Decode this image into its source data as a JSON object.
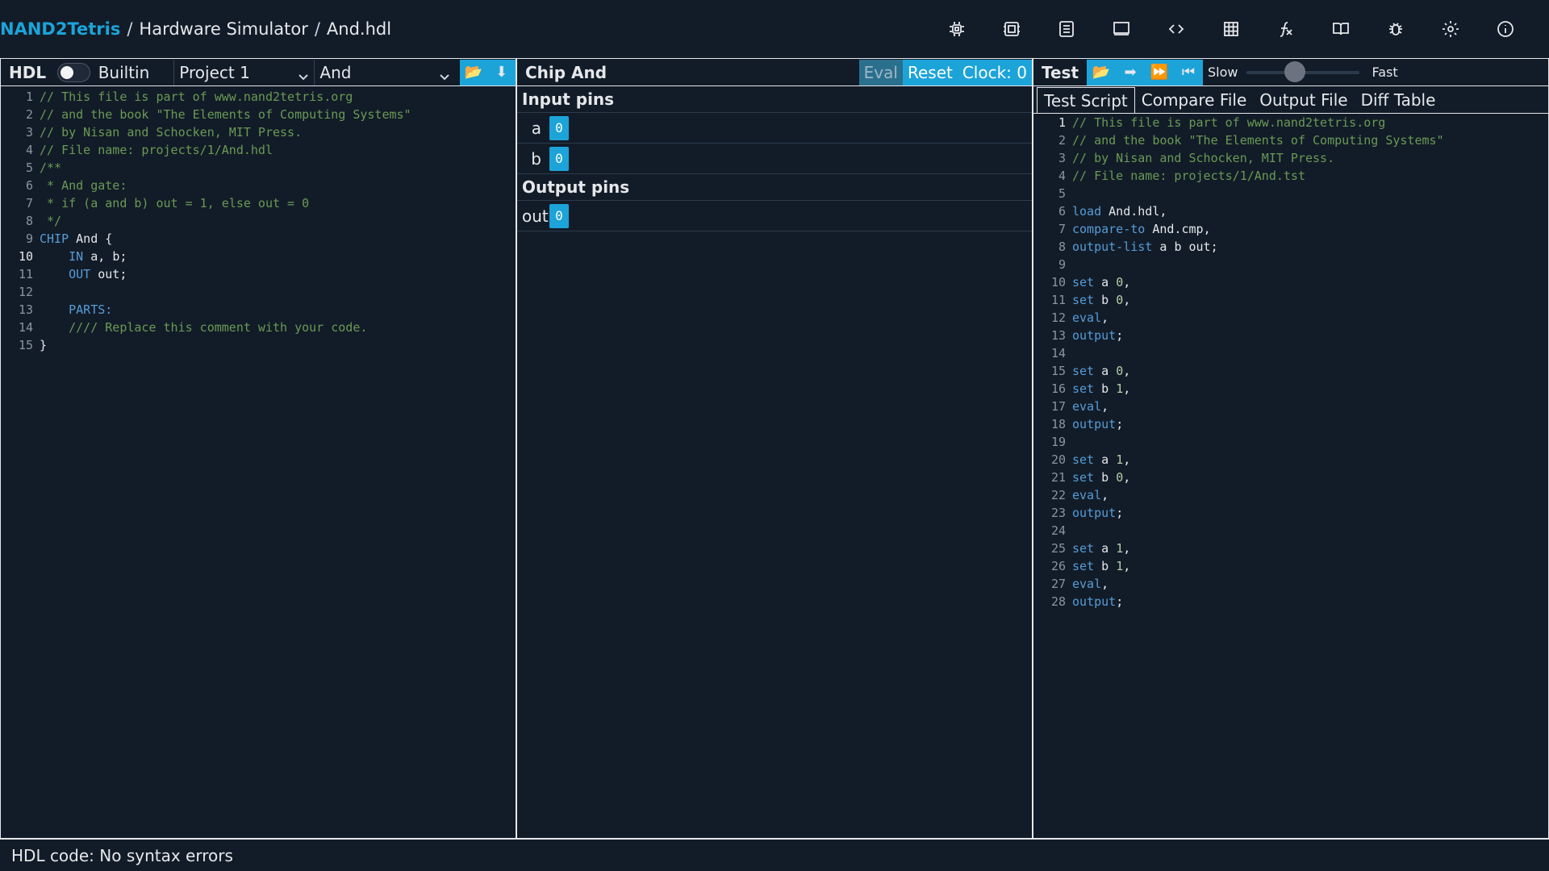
{
  "breadcrumb": {
    "brand": "NAND2Tetris",
    "section": "Hardware Simulator",
    "file": "And.hdl",
    "separator": "/"
  },
  "top_icons": [
    "chip-icon",
    "cpu-icon",
    "list-icon",
    "monitor-icon",
    "code-icon",
    "grid-icon",
    "function-icon",
    "book-icon",
    "bug-icon",
    "gear-icon",
    "info-icon"
  ],
  "hdl_panel": {
    "title": "HDL",
    "builtin_label": "Builtin",
    "project_select": "Project 1",
    "chip_select": "And",
    "code_lines": [
      "// This file is part of www.nand2tetris.org",
      "// and the book \"The Elements of Computing Systems\"",
      "// by Nisan and Schocken, MIT Press.",
      "// File name: projects/1/And.hdl",
      "/**",
      " * And gate:",
      " * if (a and b) out = 1, else out = 0",
      " */",
      "CHIP And {",
      "    IN a, b;",
      "    OUT out;",
      "",
      "    PARTS:",
      "    //// Replace this comment with your code.",
      "}"
    ]
  },
  "chip_panel": {
    "title": "Chip And",
    "eval_label": "Eval",
    "reset_label": "Reset",
    "clock_label": "Clock: 0",
    "input_header": "Input pins",
    "output_header": "Output pins",
    "inputs": [
      {
        "name": "a",
        "value": "0"
      },
      {
        "name": "b",
        "value": "0"
      }
    ],
    "outputs": [
      {
        "name": "out",
        "value": "0"
      }
    ]
  },
  "test_panel": {
    "title": "Test",
    "slow_label": "Slow",
    "fast_label": "Fast",
    "speed_level": 0.42,
    "tabs": [
      "Test Script",
      "Compare File",
      "Output File",
      "Diff Table"
    ],
    "active_tab": "Test Script",
    "code_lines": [
      "// This file is part of www.nand2tetris.org",
      "// and the book \"The Elements of Computing Systems\"",
      "// by Nisan and Schocken, MIT Press.",
      "// File name: projects/1/And.tst",
      "",
      "load And.hdl,",
      "compare-to And.cmp,",
      "output-list a b out;",
      "",
      "set a 0,",
      "set b 0,",
      "eval,",
      "output;",
      "",
      "set a 0,",
      "set b 1,",
      "eval,",
      "output;",
      "",
      "set a 1,",
      "set b 0,",
      "eval,",
      "output;",
      "",
      "set a 1,",
      "set b 1,",
      "eval,",
      "output;"
    ]
  },
  "status": {
    "text": "HDL code: No syntax errors"
  },
  "colors": {
    "accent": "#1ca4d9",
    "background": "#121c28",
    "comment": "#6a9955",
    "keyword": "#569cd6"
  }
}
